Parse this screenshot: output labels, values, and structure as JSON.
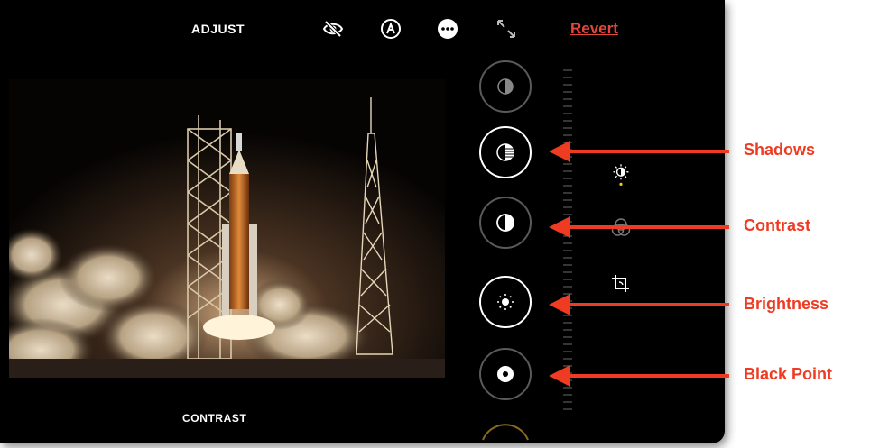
{
  "toolbar": {
    "mode_title": "ADJUST",
    "revert_label": "Revert",
    "icons": [
      "hide-icon",
      "markup-icon",
      "more-icon",
      "expand-icon"
    ]
  },
  "photo": {
    "description_icon": "rocket-launch-photo"
  },
  "adjustment": {
    "current": "CONTRAST"
  },
  "dials": [
    "highlights-dial",
    "shadows-dial",
    "contrast-dial",
    "brightness-dial",
    "black-point-dial",
    "saturation-dial"
  ],
  "side_tools": [
    "adjust-icon",
    "filters-icon",
    "crop-icon"
  ],
  "annotations": {
    "shadows": "Shadows",
    "contrast": "Contrast",
    "brightness": "Brightness",
    "black_point": "Black Point"
  },
  "colors": {
    "accent": "#e5463a",
    "annotation": "#ee3b22",
    "active_dot": "#f5c518"
  }
}
